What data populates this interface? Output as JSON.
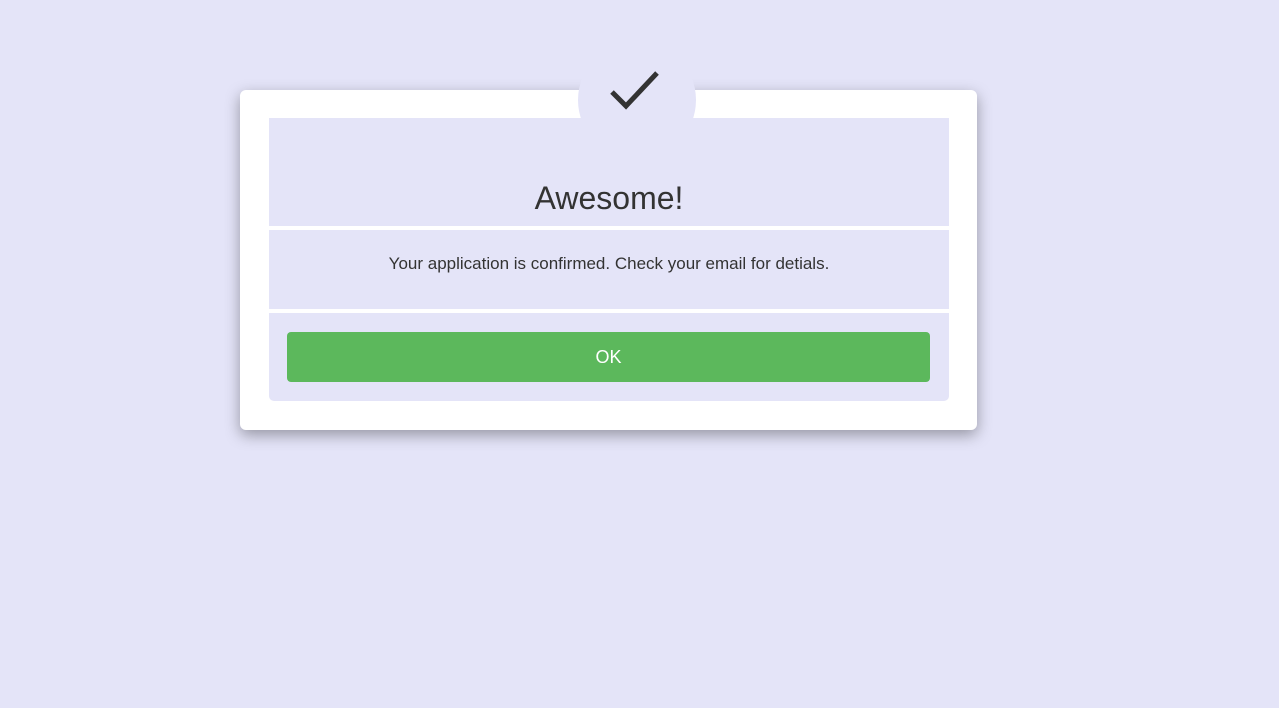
{
  "modal": {
    "icon": "checkmark-icon",
    "title": "Awesome!",
    "message": "Your application is confirmed. Check your email for detials.",
    "ok_label": "OK"
  },
  "colors": {
    "background": "#e4e4f8",
    "card": "#ffffff",
    "button": "#5cb85c",
    "text": "#333333"
  }
}
